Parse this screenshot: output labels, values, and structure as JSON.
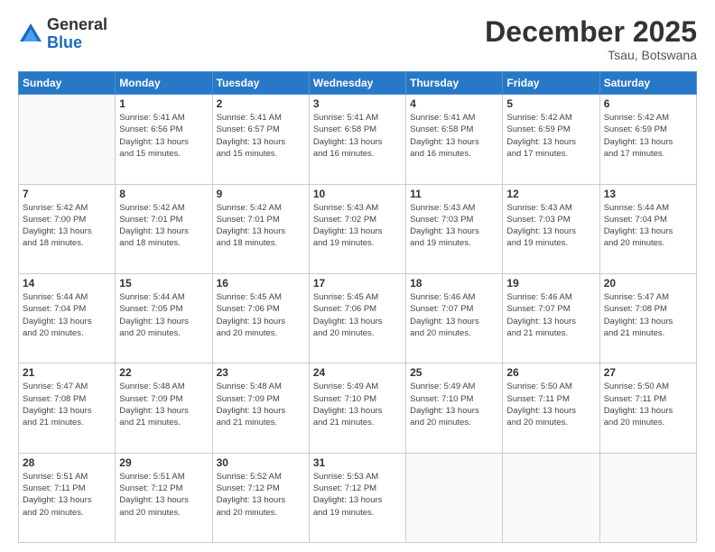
{
  "header": {
    "logo_general": "General",
    "logo_blue": "Blue",
    "month": "December 2025",
    "location": "Tsau, Botswana"
  },
  "weekdays": [
    "Sunday",
    "Monday",
    "Tuesday",
    "Wednesday",
    "Thursday",
    "Friday",
    "Saturday"
  ],
  "weeks": [
    [
      {
        "day": "",
        "info": ""
      },
      {
        "day": "1",
        "info": "Sunrise: 5:41 AM\nSunset: 6:56 PM\nDaylight: 13 hours\nand 15 minutes."
      },
      {
        "day": "2",
        "info": "Sunrise: 5:41 AM\nSunset: 6:57 PM\nDaylight: 13 hours\nand 15 minutes."
      },
      {
        "day": "3",
        "info": "Sunrise: 5:41 AM\nSunset: 6:58 PM\nDaylight: 13 hours\nand 16 minutes."
      },
      {
        "day": "4",
        "info": "Sunrise: 5:41 AM\nSunset: 6:58 PM\nDaylight: 13 hours\nand 16 minutes."
      },
      {
        "day": "5",
        "info": "Sunrise: 5:42 AM\nSunset: 6:59 PM\nDaylight: 13 hours\nand 17 minutes."
      },
      {
        "day": "6",
        "info": "Sunrise: 5:42 AM\nSunset: 6:59 PM\nDaylight: 13 hours\nand 17 minutes."
      }
    ],
    [
      {
        "day": "7",
        "info": "Sunrise: 5:42 AM\nSunset: 7:00 PM\nDaylight: 13 hours\nand 18 minutes."
      },
      {
        "day": "8",
        "info": "Sunrise: 5:42 AM\nSunset: 7:01 PM\nDaylight: 13 hours\nand 18 minutes."
      },
      {
        "day": "9",
        "info": "Sunrise: 5:42 AM\nSunset: 7:01 PM\nDaylight: 13 hours\nand 18 minutes."
      },
      {
        "day": "10",
        "info": "Sunrise: 5:43 AM\nSunset: 7:02 PM\nDaylight: 13 hours\nand 19 minutes."
      },
      {
        "day": "11",
        "info": "Sunrise: 5:43 AM\nSunset: 7:03 PM\nDaylight: 13 hours\nand 19 minutes."
      },
      {
        "day": "12",
        "info": "Sunrise: 5:43 AM\nSunset: 7:03 PM\nDaylight: 13 hours\nand 19 minutes."
      },
      {
        "day": "13",
        "info": "Sunrise: 5:44 AM\nSunset: 7:04 PM\nDaylight: 13 hours\nand 20 minutes."
      }
    ],
    [
      {
        "day": "14",
        "info": "Sunrise: 5:44 AM\nSunset: 7:04 PM\nDaylight: 13 hours\nand 20 minutes."
      },
      {
        "day": "15",
        "info": "Sunrise: 5:44 AM\nSunset: 7:05 PM\nDaylight: 13 hours\nand 20 minutes."
      },
      {
        "day": "16",
        "info": "Sunrise: 5:45 AM\nSunset: 7:06 PM\nDaylight: 13 hours\nand 20 minutes."
      },
      {
        "day": "17",
        "info": "Sunrise: 5:45 AM\nSunset: 7:06 PM\nDaylight: 13 hours\nand 20 minutes."
      },
      {
        "day": "18",
        "info": "Sunrise: 5:46 AM\nSunset: 7:07 PM\nDaylight: 13 hours\nand 20 minutes."
      },
      {
        "day": "19",
        "info": "Sunrise: 5:46 AM\nSunset: 7:07 PM\nDaylight: 13 hours\nand 21 minutes."
      },
      {
        "day": "20",
        "info": "Sunrise: 5:47 AM\nSunset: 7:08 PM\nDaylight: 13 hours\nand 21 minutes."
      }
    ],
    [
      {
        "day": "21",
        "info": "Sunrise: 5:47 AM\nSunset: 7:08 PM\nDaylight: 13 hours\nand 21 minutes."
      },
      {
        "day": "22",
        "info": "Sunrise: 5:48 AM\nSunset: 7:09 PM\nDaylight: 13 hours\nand 21 minutes."
      },
      {
        "day": "23",
        "info": "Sunrise: 5:48 AM\nSunset: 7:09 PM\nDaylight: 13 hours\nand 21 minutes."
      },
      {
        "day": "24",
        "info": "Sunrise: 5:49 AM\nSunset: 7:10 PM\nDaylight: 13 hours\nand 21 minutes."
      },
      {
        "day": "25",
        "info": "Sunrise: 5:49 AM\nSunset: 7:10 PM\nDaylight: 13 hours\nand 20 minutes."
      },
      {
        "day": "26",
        "info": "Sunrise: 5:50 AM\nSunset: 7:11 PM\nDaylight: 13 hours\nand 20 minutes."
      },
      {
        "day": "27",
        "info": "Sunrise: 5:50 AM\nSunset: 7:11 PM\nDaylight: 13 hours\nand 20 minutes."
      }
    ],
    [
      {
        "day": "28",
        "info": "Sunrise: 5:51 AM\nSunset: 7:11 PM\nDaylight: 13 hours\nand 20 minutes."
      },
      {
        "day": "29",
        "info": "Sunrise: 5:51 AM\nSunset: 7:12 PM\nDaylight: 13 hours\nand 20 minutes."
      },
      {
        "day": "30",
        "info": "Sunrise: 5:52 AM\nSunset: 7:12 PM\nDaylight: 13 hours\nand 20 minutes."
      },
      {
        "day": "31",
        "info": "Sunrise: 5:53 AM\nSunset: 7:12 PM\nDaylight: 13 hours\nand 19 minutes."
      },
      {
        "day": "",
        "info": ""
      },
      {
        "day": "",
        "info": ""
      },
      {
        "day": "",
        "info": ""
      }
    ]
  ]
}
